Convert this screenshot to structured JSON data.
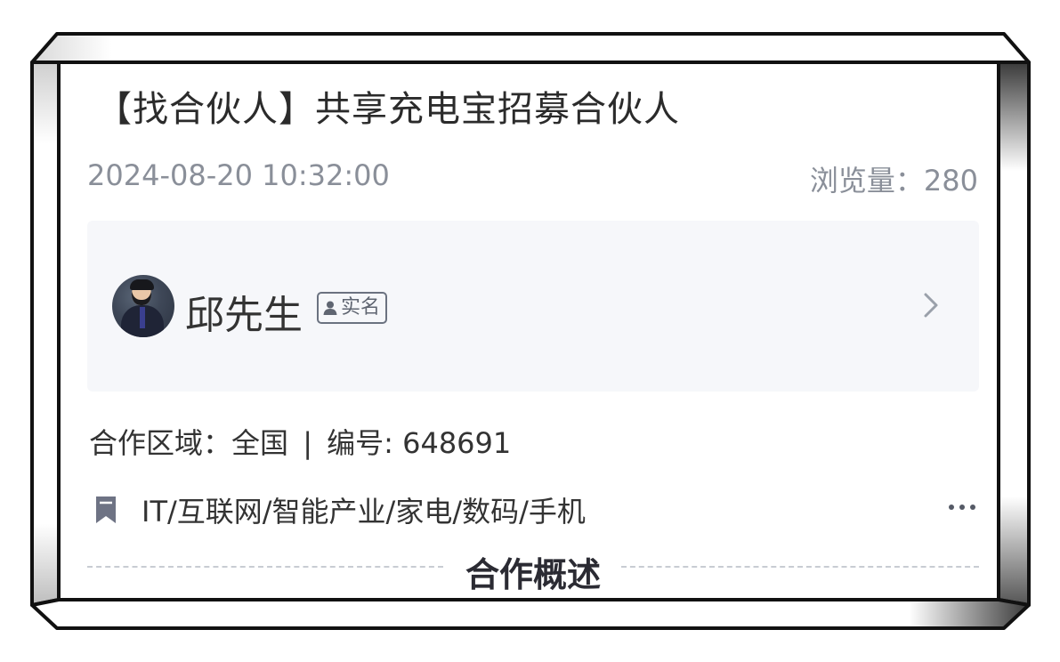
{
  "post": {
    "title": "【找合伙人】共享充电宝招募合伙人",
    "date": "2024-08-20 10:32:00",
    "views": "浏览量：280"
  },
  "publisher": {
    "name": "邱先生",
    "verified_label": "实名"
  },
  "info": {
    "region": "合作区域：全国",
    "separator": "|",
    "number": "编号: 648691"
  },
  "tags": {
    "text": "IT/互联网/智能产业/家电/数码/手机"
  },
  "section": {
    "title": "合作概述"
  },
  "icons": {
    "avatar": "avatar-photo",
    "badge": "person-icon",
    "arrow": "chevron-right-icon",
    "tag": "bookmark-icon",
    "more": "more-dots-icon"
  },
  "colors": {
    "text_primary": "#333333",
    "text_secondary": "#8a8f99",
    "card_bg": "#f6f7fa",
    "icon_muted": "#6b7280"
  }
}
